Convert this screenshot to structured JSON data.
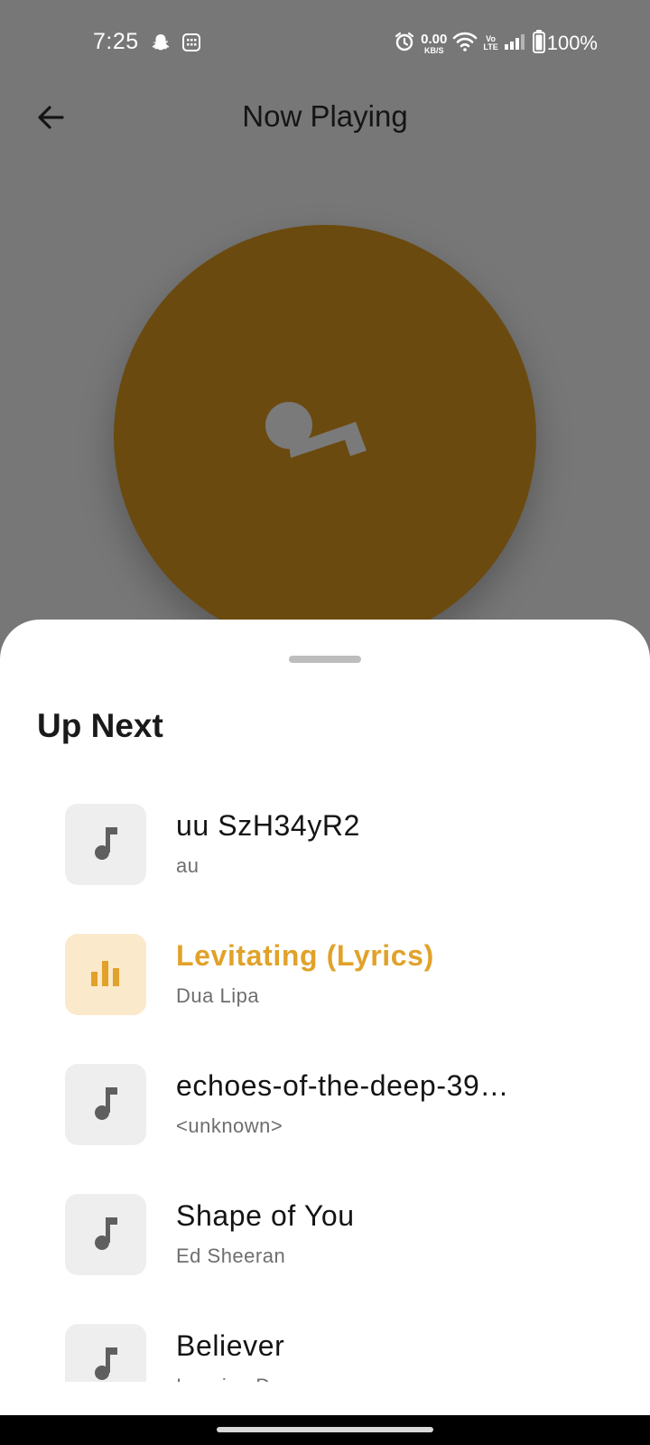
{
  "status_bar": {
    "time": "7:25",
    "net_speed_value": "0.00",
    "net_speed_unit": "KB/S",
    "volte_top": "Vo",
    "volte_bottom": "LTE",
    "battery": "100%"
  },
  "header": {
    "title": "Now Playing",
    "back_icon": "arrow-left-icon"
  },
  "album_art": {
    "color": "#6b4a0f",
    "icon": "music-note-placeholder-icon"
  },
  "sheet": {
    "title": "Up Next",
    "items": [
      {
        "title": "uu SzH34yR2",
        "artist": "au",
        "icon": "music-note-icon"
      },
      {
        "title": "Levitating (Lyrics)",
        "artist": "Dua Lipa",
        "icon": "equalizer-icon",
        "playing": true
      },
      {
        "title": "echoes-of-the-deep-39…",
        "artist": "<unknown>",
        "icon": "music-note-icon"
      },
      {
        "title": "Shape of You",
        "artist": "Ed Sheeran",
        "icon": "music-note-icon"
      },
      {
        "title": "Believer",
        "artist": "Imagine Dragons",
        "icon": "music-note-icon"
      }
    ]
  },
  "colors": {
    "accent": "#e1a22a",
    "accent_bg": "#fbe9cc",
    "scrim": "#777777"
  }
}
